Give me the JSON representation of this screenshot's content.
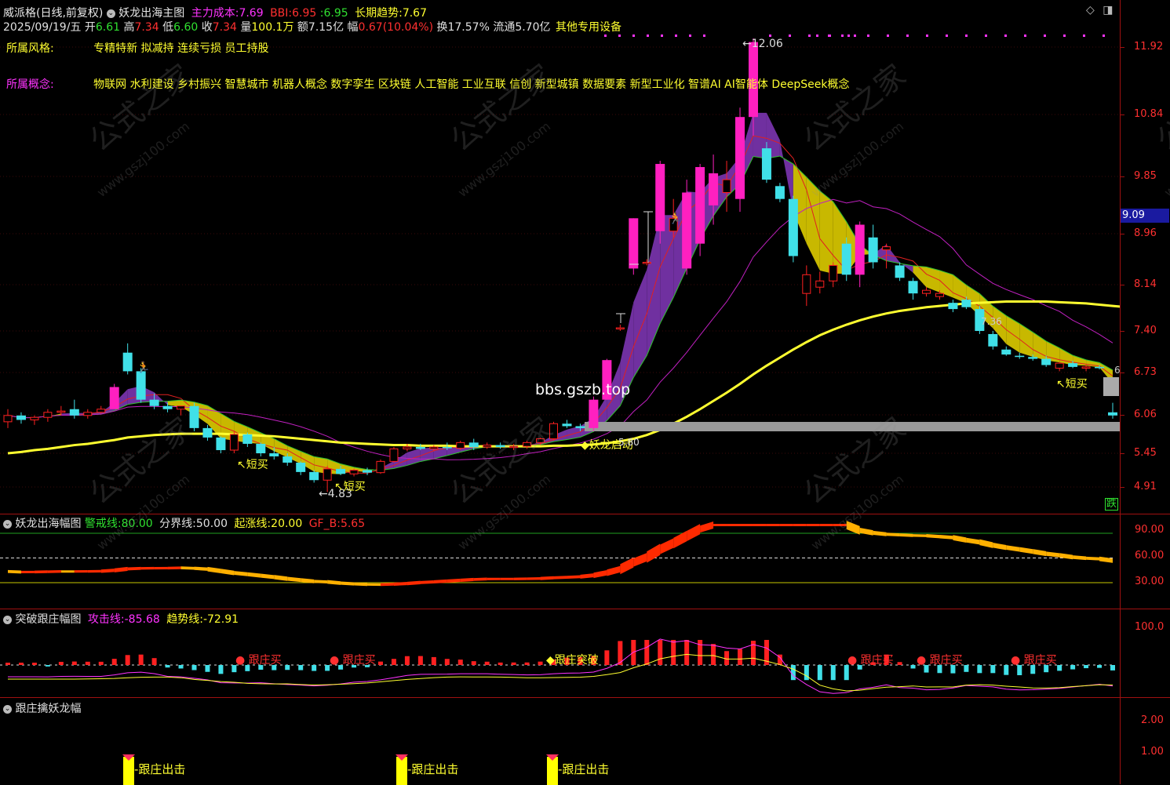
{
  "header": {
    "stock_name": "威派格(日线,前复权)",
    "indicator_name": "妖龙出海主图",
    "cost_label": "主力成本:",
    "cost_value": "7.69",
    "bbi_label": "BBI:",
    "bbi_value": "6.95",
    "bbi_sep": ":",
    "bbi_value2": "6.95",
    "trend_label": "长期趋势:",
    "trend_value": "7.67",
    "date": "2025/09/19/五",
    "open_label": "开",
    "open_value": "6.61",
    "high_label": "高",
    "high_value": "7.34",
    "low_label": "低",
    "low_value": "6.60",
    "close_label": "收",
    "close_value": "7.34",
    "vol_label": "量",
    "vol_value": "100.1万",
    "amt_label": "额",
    "amt_value": "7.15亿",
    "chg_label": "幅",
    "chg_value": "0.67(10.04%)",
    "turn_label": "换",
    "turn_value": "17.57%",
    "float_label": "流通",
    "float_value": "5.70亿",
    "industry": "其他专用设备"
  },
  "info": {
    "style_label": "所属风格:",
    "style_value": "专精特新 拟减持 连续亏损 员工持股",
    "concept_label": "所属概念:",
    "concept_value": "物联网 水利建设 乡村振兴 智慧城市 机器人概念 数字孪生 区块链 人工智能 工业互联 信创 新型城镇 数据要素 新型工业化 智谱AI AI智能体 DeepSeek概念"
  },
  "price_axis": [
    "11.92",
    "10.84",
    "9.85",
    "8.96",
    "8.14",
    "7.40",
    "6.73",
    "6.06",
    "5.45",
    "4.91"
  ],
  "current_price_tag": "9.09",
  "main_annotations": {
    "high_label": "12.06",
    "low_label": "4.83",
    "buy1": "短买",
    "buy2": "短买",
    "buy3": "短买",
    "launch_label": "妖龙启动",
    "launch_price": "5.80",
    "right_label": "7.36",
    "right_label2": "6",
    "watermark_site": "bbs.gszb.top",
    "drop_badge": "跌"
  },
  "watermarks": [
    "公式之家",
    "www.gszj100.com"
  ],
  "panel2": {
    "title": "妖龙出海幅图",
    "warn_label": "警戒线:",
    "warn_value": "80.00",
    "divide_label": "分界线:",
    "divide_value": "50.00",
    "rise_label": "起涨线:",
    "rise_value": "20.00",
    "gf_label": "GF_B:",
    "gf_value": "5.65",
    "axis": [
      "90.00",
      "60.00",
      "30.00"
    ]
  },
  "panel3": {
    "title": "突破跟庄幅图",
    "attack_label": "攻击线:",
    "attack_value": "-85.68",
    "trend_label": "趋势线:",
    "trend_value": "-72.91",
    "axis": [
      "100.0"
    ],
    "signals": [
      "跟庄买",
      "跟庄买",
      "跟庄突破",
      "跟庄买",
      "跟庄买",
      "跟庄买"
    ]
  },
  "panel4": {
    "title": "跟庄擒妖龙幅",
    "axis": [
      "2.00",
      "1.00"
    ],
    "signals": [
      "跟庄出击",
      "跟庄出击",
      "跟庄出击"
    ]
  },
  "chart_data": {
    "type": "candlestick",
    "title": "威派格(日线,前复权)",
    "ylim": [
      4.6,
      12.3
    ],
    "y_ticks": [
      11.92,
      10.84,
      9.85,
      8.96,
      8.14,
      7.4,
      6.73,
      6.06,
      5.45,
      4.91
    ],
    "candles": [
      {
        "o": 5.95,
        "h": 6.15,
        "l": 5.85,
        "c": 6.05
      },
      {
        "o": 6.05,
        "h": 6.1,
        "l": 5.92,
        "c": 5.98
      },
      {
        "o": 5.98,
        "h": 6.05,
        "l": 5.9,
        "c": 6.02
      },
      {
        "o": 6.02,
        "h": 6.15,
        "l": 5.95,
        "c": 6.1
      },
      {
        "o": 6.1,
        "h": 6.2,
        "l": 6.05,
        "c": 6.12
      },
      {
        "o": 6.15,
        "h": 6.3,
        "l": 6.0,
        "c": 6.05
      },
      {
        "o": 6.05,
        "h": 6.15,
        "l": 6.0,
        "c": 6.1
      },
      {
        "o": 6.1,
        "h": 6.2,
        "l": 6.08,
        "c": 6.15
      },
      {
        "o": 6.15,
        "h": 6.55,
        "l": 6.15,
        "c": 6.5
      },
      {
        "o": 7.05,
        "h": 7.2,
        "l": 6.7,
        "c": 6.75
      },
      {
        "o": 6.75,
        "h": 6.8,
        "l": 6.25,
        "c": 6.3
      },
      {
        "o": 6.3,
        "h": 6.4,
        "l": 6.15,
        "c": 6.2
      },
      {
        "o": 6.2,
        "h": 6.25,
        "l": 6.1,
        "c": 6.15
      },
      {
        "o": 6.15,
        "h": 6.2,
        "l": 6.05,
        "c": 6.2
      },
      {
        "o": 6.2,
        "h": 6.25,
        "l": 5.8,
        "c": 5.85
      },
      {
        "o": 5.85,
        "h": 5.9,
        "l": 5.65,
        "c": 5.7
      },
      {
        "o": 5.7,
        "h": 5.72,
        "l": 5.45,
        "c": 5.5
      },
      {
        "o": 5.5,
        "h": 5.8,
        "l": 5.45,
        "c": 5.75
      },
      {
        "o": 5.75,
        "h": 5.78,
        "l": 5.55,
        "c": 5.6
      },
      {
        "o": 5.6,
        "h": 5.62,
        "l": 5.4,
        "c": 5.45
      },
      {
        "o": 5.45,
        "h": 5.55,
        "l": 5.35,
        "c": 5.4
      },
      {
        "o": 5.4,
        "h": 5.45,
        "l": 5.25,
        "c": 5.3
      },
      {
        "o": 5.3,
        "h": 5.32,
        "l": 5.1,
        "c": 5.15
      },
      {
        "o": 5.15,
        "h": 5.18,
        "l": 4.98,
        "c": 5.02
      },
      {
        "o": 5.02,
        "h": 5.25,
        "l": 4.83,
        "c": 5.2
      },
      {
        "o": 5.2,
        "h": 5.25,
        "l": 5.1,
        "c": 5.12
      },
      {
        "o": 5.12,
        "h": 5.2,
        "l": 5.08,
        "c": 5.18
      },
      {
        "o": 5.18,
        "h": 5.22,
        "l": 5.1,
        "c": 5.14
      },
      {
        "o": 5.14,
        "h": 5.35,
        "l": 5.12,
        "c": 5.32
      },
      {
        "o": 5.32,
        "h": 5.55,
        "l": 5.3,
        "c": 5.52
      },
      {
        "o": 5.52,
        "h": 5.6,
        "l": 5.48,
        "c": 5.55
      },
      {
        "o": 5.55,
        "h": 5.6,
        "l": 5.5,
        "c": 5.52
      },
      {
        "o": 5.52,
        "h": 5.58,
        "l": 5.48,
        "c": 5.55
      },
      {
        "o": 5.55,
        "h": 5.62,
        "l": 5.5,
        "c": 5.53
      },
      {
        "o": 5.53,
        "h": 5.65,
        "l": 5.5,
        "c": 5.62
      },
      {
        "o": 5.62,
        "h": 5.68,
        "l": 5.5,
        "c": 5.55
      },
      {
        "o": 5.55,
        "h": 5.62,
        "l": 5.52,
        "c": 5.58
      },
      {
        "o": 5.58,
        "h": 5.62,
        "l": 5.52,
        "c": 5.55
      },
      {
        "o": 5.55,
        "h": 5.6,
        "l": 5.5,
        "c": 5.56
      },
      {
        "o": 5.56,
        "h": 5.65,
        "l": 5.52,
        "c": 5.62
      },
      {
        "o": 5.62,
        "h": 5.7,
        "l": 5.58,
        "c": 5.68
      },
      {
        "o": 5.68,
        "h": 5.95,
        "l": 5.65,
        "c": 5.92
      },
      {
        "o": 5.92,
        "h": 5.98,
        "l": 5.85,
        "c": 5.88
      },
      {
        "o": 5.88,
        "h": 5.92,
        "l": 5.8,
        "c": 5.85
      },
      {
        "o": 5.85,
        "h": 6.35,
        "l": 5.8,
        "c": 6.3
      },
      {
        "o": 6.3,
        "h": 6.95,
        "l": 6.3,
        "c": 6.93
      },
      {
        "o": 7.45,
        "h": 7.5,
        "l": 7.4,
        "c": 7.45
      },
      {
        "o": 8.4,
        "h": 9.2,
        "l": 8.3,
        "c": 9.2
      },
      {
        "o": 8.5,
        "h": 8.55,
        "l": 8.45,
        "c": 8.5
      },
      {
        "o": 9.0,
        "h": 10.1,
        "l": 8.8,
        "c": 10.05
      },
      {
        "o": 9.0,
        "h": 9.5,
        "l": 8.9,
        "c": 9.2
      },
      {
        "o": 8.4,
        "h": 9.8,
        "l": 8.3,
        "c": 9.6
      },
      {
        "o": 8.8,
        "h": 10.05,
        "l": 8.6,
        "c": 10.0
      },
      {
        "o": 9.4,
        "h": 10.2,
        "l": 9.1,
        "c": 9.9
      },
      {
        "o": 9.6,
        "h": 10.1,
        "l": 9.3,
        "c": 9.8
      },
      {
        "o": 9.5,
        "h": 10.95,
        "l": 9.3,
        "c": 10.8
      },
      {
        "o": 10.8,
        "h": 12.06,
        "l": 10.5,
        "c": 12.0
      },
      {
        "o": 10.3,
        "h": 10.4,
        "l": 9.75,
        "c": 9.8
      },
      {
        "o": 9.7,
        "h": 9.75,
        "l": 9.45,
        "c": 9.5
      },
      {
        "o": 9.5,
        "h": 9.55,
        "l": 8.5,
        "c": 8.6
      },
      {
        "o": 8.0,
        "h": 8.45,
        "l": 7.8,
        "c": 8.3
      },
      {
        "o": 8.1,
        "h": 8.35,
        "l": 8.0,
        "c": 8.2
      },
      {
        "o": 8.2,
        "h": 8.5,
        "l": 8.1,
        "c": 8.45
      },
      {
        "o": 8.8,
        "h": 8.9,
        "l": 8.2,
        "c": 8.3
      },
      {
        "o": 8.3,
        "h": 9.15,
        "l": 8.1,
        "c": 9.1
      },
      {
        "o": 8.9,
        "h": 9.1,
        "l": 8.4,
        "c": 8.5
      },
      {
        "o": 8.7,
        "h": 8.8,
        "l": 8.4,
        "c": 8.75
      },
      {
        "o": 8.45,
        "h": 8.5,
        "l": 8.2,
        "c": 8.25
      },
      {
        "o": 8.2,
        "h": 8.25,
        "l": 7.9,
        "c": 8.0
      },
      {
        "o": 8.0,
        "h": 8.1,
        "l": 7.95,
        "c": 8.05
      },
      {
        "o": 7.95,
        "h": 8.05,
        "l": 7.9,
        "c": 8.0
      },
      {
        "o": 7.85,
        "h": 7.9,
        "l": 7.7,
        "c": 7.75
      },
      {
        "o": 7.9,
        "h": 7.95,
        "l": 7.75,
        "c": 7.78
      },
      {
        "o": 7.75,
        "h": 7.8,
        "l": 7.35,
        "c": 7.4
      },
      {
        "o": 7.35,
        "h": 7.4,
        "l": 7.1,
        "c": 7.15
      },
      {
        "o": 7.1,
        "h": 7.15,
        "l": 7.0,
        "c": 7.02
      },
      {
        "o": 7.0,
        "h": 7.05,
        "l": 6.95,
        "c": 6.98
      },
      {
        "o": 6.98,
        "h": 7.02,
        "l": 6.92,
        "c": 6.95
      },
      {
        "o": 6.95,
        "h": 7.0,
        "l": 6.82,
        "c": 6.85
      },
      {
        "o": 6.8,
        "h": 6.9,
        "l": 6.75,
        "c": 6.88
      },
      {
        "o": 6.88,
        "h": 6.92,
        "l": 6.8,
        "c": 6.82
      },
      {
        "o": 6.8,
        "h": 6.85,
        "l": 6.75,
        "c": 6.82
      },
      {
        "o": 6.82,
        "h": 6.85,
        "l": 6.78,
        "c": 6.8
      },
      {
        "o": 6.1,
        "h": 6.25,
        "l": 6.0,
        "c": 6.05
      }
    ],
    "trend_line": [
      5.45,
      5.47,
      5.5,
      5.52,
      5.55,
      5.58,
      5.6,
      5.63,
      5.66,
      5.7,
      5.72,
      5.74,
      5.75,
      5.76,
      5.76,
      5.76,
      5.76,
      5.75,
      5.74,
      5.73,
      5.72,
      5.7,
      5.68,
      5.66,
      5.64,
      5.62,
      5.61,
      5.6,
      5.59,
      5.58,
      5.58,
      5.57,
      5.57,
      5.57,
      5.56,
      5.56,
      5.56,
      5.56,
      5.56,
      5.56,
      5.56,
      5.57,
      5.57,
      5.58,
      5.59,
      5.61,
      5.64,
      5.68,
      5.74,
      5.82,
      5.92,
      6.03,
      6.15,
      6.28,
      6.41,
      6.55,
      6.7,
      6.84,
      6.97,
      7.1,
      7.22,
      7.33,
      7.42,
      7.5,
      7.57,
      7.63,
      7.68,
      7.72,
      7.75,
      7.78,
      7.8,
      7.82,
      7.84,
      7.85,
      7.86,
      7.87,
      7.87,
      7.87,
      7.87,
      7.86,
      7.85,
      7.84,
      7.82,
      7.8,
      7.78,
      7.76,
      7.73,
      7.7
    ]
  }
}
